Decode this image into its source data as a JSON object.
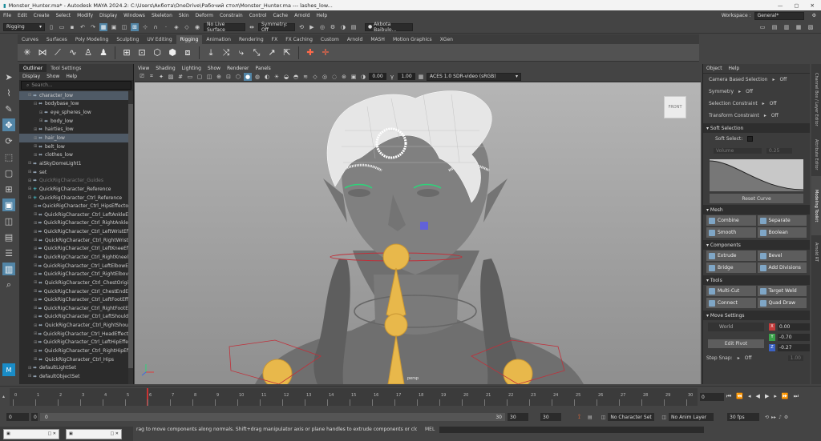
{
  "window": {
    "title": "Monster_Hunter.ma* - Autodesk MAYA 2024.2: C:\\Users\\Акбота\\OneDrive\\Рабочий стол\\Monster_Hunter.ma  ---  lashes_low..."
  },
  "menubar": {
    "items": [
      "File",
      "Edit",
      "Create",
      "Select",
      "Modify",
      "Display",
      "Windows",
      "Skeleton",
      "Skin",
      "Deform",
      "Constrain",
      "Control",
      "Cache",
      "Arnold",
      "Help"
    ],
    "workspace_label": "Workspace :",
    "workspace_value": "General*"
  },
  "statusline": {
    "menuset": "Rigging",
    "live_surface": "No Live Surface",
    "symmetry": "Symmetry: Off",
    "user": "Akbota Baibulo..."
  },
  "shelf": {
    "tabs": [
      "Curves",
      "Surfaces",
      "Poly Modeling",
      "Sculpting",
      "UV Editing",
      "Rigging",
      "Animation",
      "Rendering",
      "FX",
      "FX Caching",
      "Custom",
      "Arnold",
      "MASH",
      "Motion Graphics",
      "XGen"
    ],
    "active_tab": "Rigging"
  },
  "outliner": {
    "tabs": [
      "Outliner",
      "Tool Settings"
    ],
    "menu": [
      "Display",
      "Show",
      "Help"
    ],
    "search_placeholder": "Search...",
    "items": [
      {
        "label": "character_low",
        "depth": 1,
        "expanded": true,
        "selected": true
      },
      {
        "label": "bodybase_low",
        "depth": 2,
        "expanded": true
      },
      {
        "label": "eye_spheres_low",
        "depth": 3
      },
      {
        "label": "body_low",
        "depth": 3
      },
      {
        "label": "hairties_low",
        "depth": 2
      },
      {
        "label": "hair_low",
        "depth": 2,
        "selected": true
      },
      {
        "label": "belt_low",
        "depth": 2
      },
      {
        "label": "clothes_low",
        "depth": 2
      },
      {
        "label": "aiSkyDomeLight1",
        "depth": 1
      },
      {
        "label": "set",
        "depth": 1
      },
      {
        "label": "QuickRigCharacter_Guides",
        "depth": 1,
        "dim": true
      },
      {
        "label": "QuickRigCharacter_Reference",
        "depth": 1,
        "cyan": true
      },
      {
        "label": "QuickRigCharacter_Ctrl_Reference",
        "depth": 1,
        "cyan": true
      },
      {
        "label": "QuickRigCharacter_Ctrl_HipsEffecto",
        "depth": 2
      },
      {
        "label": "QuickRigCharacter_Ctrl_LeftAnkleE",
        "depth": 2
      },
      {
        "label": "QuickRigCharacter_Ctrl_RightAnkle",
        "depth": 2
      },
      {
        "label": "QuickRigCharacter_Ctrl_LeftWristEf",
        "depth": 2
      },
      {
        "label": "QuickRigCharacter_Ctrl_RightWrist",
        "depth": 2
      },
      {
        "label": "QuickRigCharacter_Ctrl_LeftKneeEf",
        "depth": 2
      },
      {
        "label": "QuickRigCharacter_Ctrl_RightKneel",
        "depth": 2
      },
      {
        "label": "QuickRigCharacter_Ctrl_LeftElbowE",
        "depth": 2
      },
      {
        "label": "QuickRigCharacter_Ctrl_RightElbov",
        "depth": 2
      },
      {
        "label": "QuickRigCharacter_Ctrl_ChestOrigi",
        "depth": 2
      },
      {
        "label": "QuickRigCharacter_Ctrl_ChestEndE",
        "depth": 2
      },
      {
        "label": "QuickRigCharacter_Ctrl_LeftFootEff",
        "depth": 2
      },
      {
        "label": "QuickRigCharacter_Ctrl_RightFootE",
        "depth": 2
      },
      {
        "label": "QuickRigCharacter_Ctrl_LeftShould",
        "depth": 2
      },
      {
        "label": "QuickRigCharacter_Ctrl_RightShou",
        "depth": 2
      },
      {
        "label": "QuickRigCharacter_Ctrl_HeadEffect",
        "depth": 2
      },
      {
        "label": "QuickRigCharacter_Ctrl_LeftHipEffe",
        "depth": 2
      },
      {
        "label": "QuickRigCharacter_Ctrl_RightHipEf",
        "depth": 2
      },
      {
        "label": "QuickRigCharacter_Ctrl_Hips",
        "depth": 2
      },
      {
        "label": "defaultLightSet",
        "depth": 1
      },
      {
        "label": "defaultObjectSet",
        "depth": 1
      }
    ]
  },
  "viewport": {
    "menu": [
      "View",
      "Shading",
      "Lighting",
      "Show",
      "Renderer",
      "Panels"
    ],
    "exposure": "0.00",
    "gamma": "1.00",
    "colorspace": "ACES 1.0 SDR-video (sRGB)",
    "cube_label": "FRONT",
    "camera": "persp"
  },
  "toolkit": {
    "menu": [
      "Object",
      "Help"
    ],
    "camera_based_selection": "Camera Based Selection",
    "cbs_value": "Off",
    "symmetry": "Symmetry",
    "symmetry_value": "Off",
    "selection_constraint": "Selection Constraint",
    "sc_value": "Off",
    "transform_constraint": "Transform Constraint",
    "tc_value": "Off",
    "soft_selection": "Soft Selection",
    "soft_select": "Soft Select:",
    "falloff_mode": "Volume",
    "falloff_value": "0.25",
    "reset_curve": "Reset Curve",
    "mesh": "Mesh",
    "combine": "Combine",
    "separate": "Separate",
    "smooth": "Smooth",
    "boolean": "Boolean",
    "components": "Components",
    "extrude": "Extrude",
    "bevel": "Bevel",
    "bridge": "Bridge",
    "add_divisions": "Add Divisions",
    "tools": "Tools",
    "multicut": "Multi-Cut",
    "target_weld": "Target Weld",
    "connect": "Connect",
    "quad_draw": "Quad Draw",
    "move_settings": "Move Settings",
    "world": "World",
    "x": "0.00",
    "y": "-0.70",
    "z": "-0.27",
    "edit_pivot": "Edit Pivot",
    "step_snap": "Step Snap:",
    "step_snap_value": "Off",
    "step_snap_num": "1.00"
  },
  "sidetabs": [
    "Channel Box / Layer Editor",
    "Attribute Editor",
    "Modeling Toolkit",
    "Arnold RT"
  ],
  "timeline": {
    "ticks": [
      "0",
      "1",
      "2",
      "3",
      "4",
      "5",
      "6",
      "7",
      "8",
      "9",
      "10",
      "11",
      "12",
      "13",
      "14",
      "15",
      "16",
      "17",
      "18",
      "19",
      "20",
      "21",
      "22",
      "23",
      "24",
      "25",
      "26",
      "27",
      "28",
      "29",
      "30"
    ],
    "current_frame": "0",
    "playhead_frame": 6
  },
  "range": {
    "start": "0",
    "range_start": "0",
    "range_end": "30",
    "end": "30",
    "end2": "30",
    "character_set": "No Character Set",
    "anim_layer": "No Anim Layer",
    "fps": "30 fps"
  },
  "helpline": {
    "text": "rag to move components along normals. Shift+drag manipulator axis or plane handles to extrude components or clone objects. Ctrl+Shift+drag to cons",
    "mel": "MEL"
  },
  "colors": {
    "accent": "#5285a6",
    "joint": "#e8b84b",
    "ctrl_curve": "#c0303a",
    "wire": "#ffffff"
  }
}
